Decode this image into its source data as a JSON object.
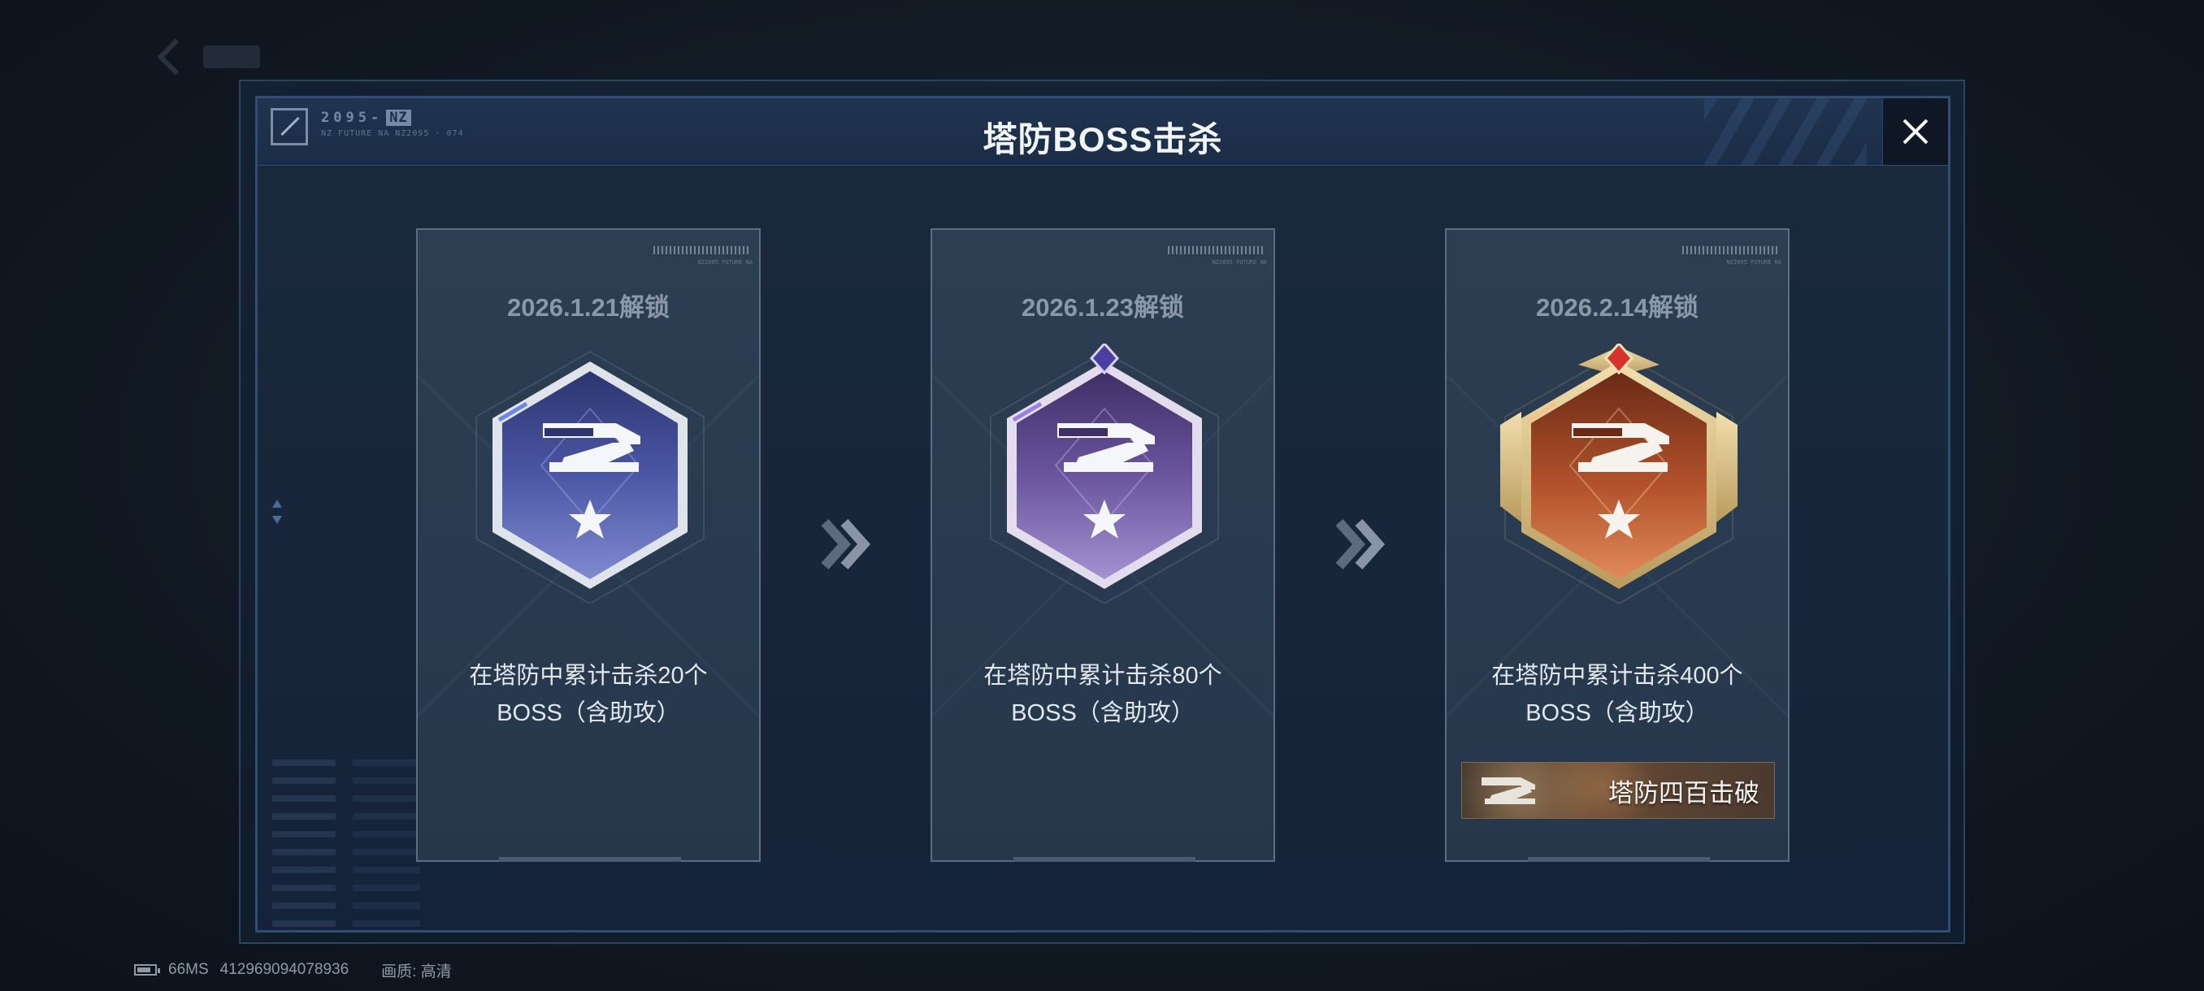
{
  "dialog": {
    "title": "塔防BOSS击杀",
    "brand_code": "2095-",
    "brand_tag": "NZ",
    "brand_sub": "NZ FUTURE NA NZ2095 · 074"
  },
  "cards": [
    {
      "unlock_date": "2026.1.21解锁",
      "desc_line1": "在塔防中累计击杀20个",
      "desc_line2": "BOSS（含助攻）",
      "tier": "blue",
      "colors": {
        "dark": "#2c3570",
        "mid": "#4b57a5",
        "light": "#7f8ad0",
        "rim": "#d8dde6"
      }
    },
    {
      "unlock_date": "2026.1.23解锁",
      "desc_line1": "在塔防中累计击杀80个",
      "desc_line2": "BOSS（含助攻）",
      "tier": "purple",
      "colors": {
        "dark": "#3e2f66",
        "mid": "#6a559e",
        "light": "#a391d0",
        "rim": "#ddd6ec"
      }
    },
    {
      "unlock_date": "2026.2.14解锁",
      "desc_line1": "在塔防中累计击杀400个",
      "desc_line2": "BOSS（含助攻）",
      "tier": "gold",
      "colors": {
        "dark": "#6a2a16",
        "mid": "#b2522c",
        "light": "#e08a5a",
        "rim": "#e6cf96"
      },
      "reward_label": "塔防四百击破"
    }
  ],
  "status_bar": {
    "ping": "66MS",
    "player_id": "412969094078936",
    "quality": "画质: 高清"
  },
  "icons": {
    "close": "close-icon",
    "next": "double-chevron-icon",
    "badge": "turret-icon",
    "star": "star-icon",
    "battery": "battery-icon"
  }
}
